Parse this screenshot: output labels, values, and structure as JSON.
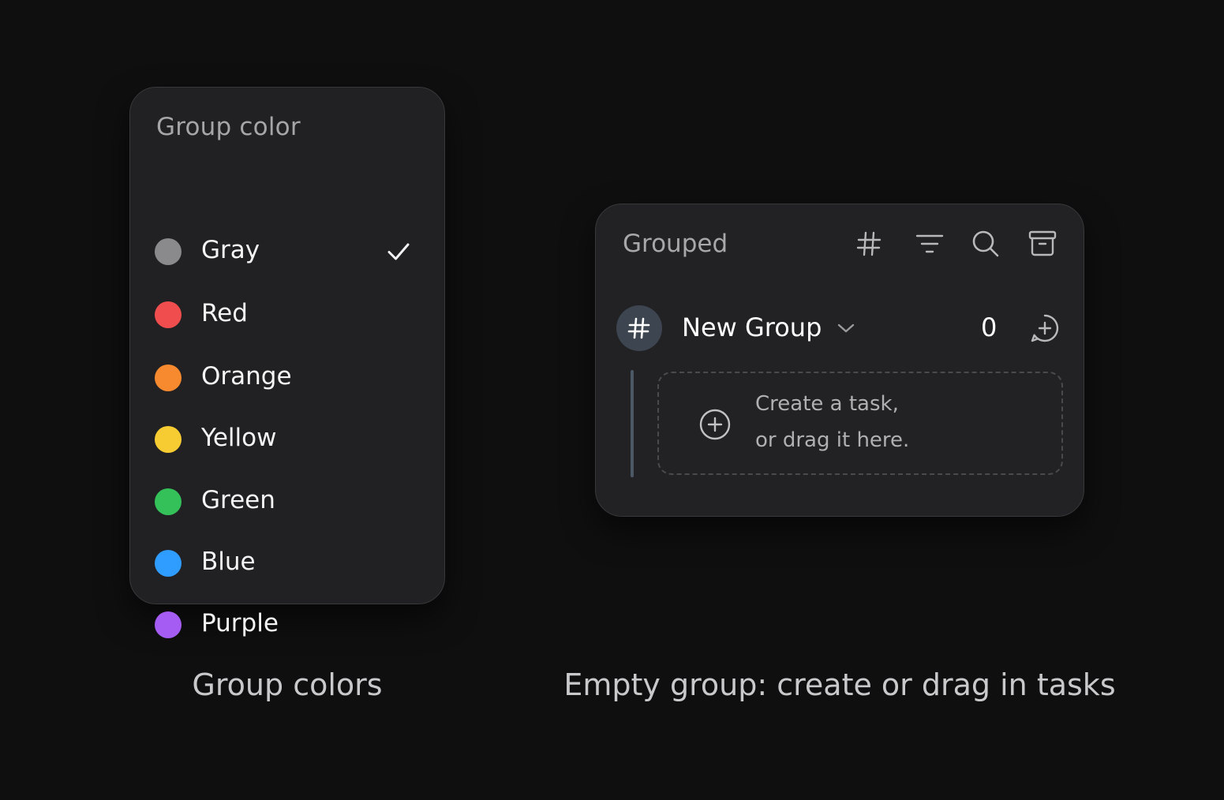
{
  "color_picker": {
    "heading": "Group color",
    "selected": "Gray",
    "options": [
      {
        "label": "Gray",
        "color": "#8a8a8c",
        "selected": true
      },
      {
        "label": "Red",
        "color": "#f04e4e",
        "selected": false
      },
      {
        "label": "Orange",
        "color": "#f78a2e",
        "selected": false
      },
      {
        "label": "Yellow",
        "color": "#f7cc33",
        "selected": false
      },
      {
        "label": "Green",
        "color": "#34c15a",
        "selected": false
      },
      {
        "label": "Blue",
        "color": "#2f9cff",
        "selected": false
      },
      {
        "label": "Purple",
        "color": "#a45cf2",
        "selected": false
      }
    ]
  },
  "grouped_panel": {
    "title": "Grouped",
    "toolbar": [
      "hash-icon",
      "filter-icon",
      "search-icon",
      "archive-icon"
    ],
    "group": {
      "name": "New Group",
      "icon": "hash-icon",
      "count": "0"
    },
    "dropzone": {
      "line1": "Create a task,",
      "line2": "or drag it here."
    }
  },
  "captions": {
    "left": "Group colors",
    "right": "Empty group: create or drag in tasks"
  }
}
